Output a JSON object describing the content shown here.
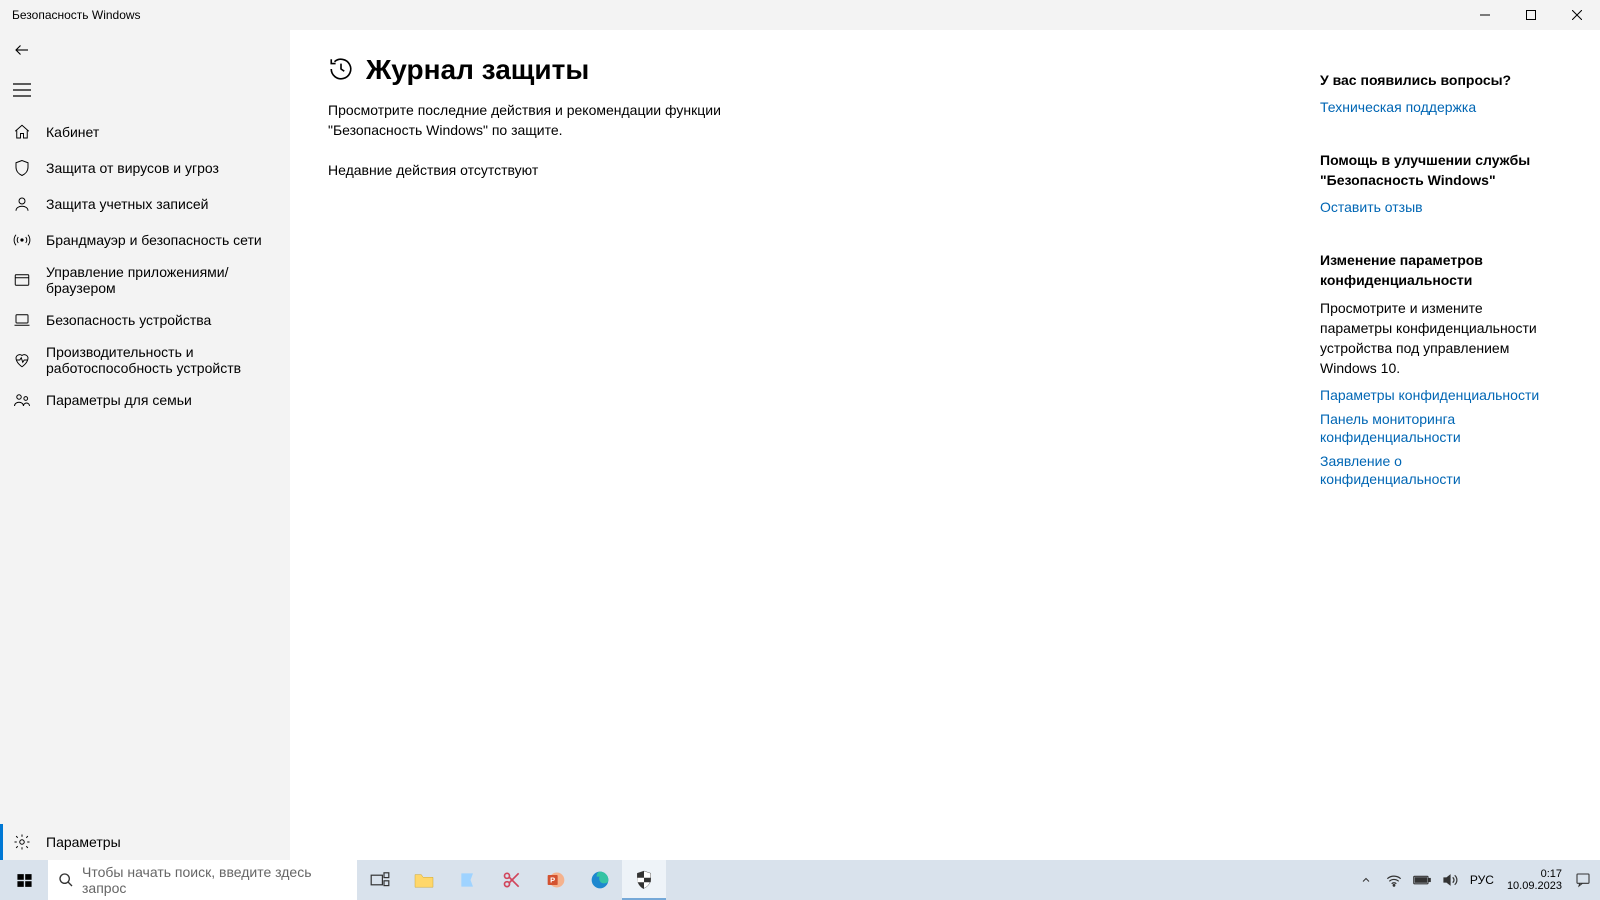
{
  "window": {
    "title": "Безопасность Windows"
  },
  "sidebar": {
    "items": [
      {
        "label": "Кабинет",
        "icon": "home-icon"
      },
      {
        "label": "Защита от вирусов и угроз",
        "icon": "shield-icon"
      },
      {
        "label": "Защита учетных записей",
        "icon": "person-icon"
      },
      {
        "label": "Брандмауэр и безопасность сети",
        "icon": "signal-icon"
      },
      {
        "label": "Управление приложениями/браузером",
        "icon": "window-icon"
      },
      {
        "label": "Безопасность устройства",
        "icon": "laptop-icon"
      },
      {
        "label": "Производительность и работоспособность устройств",
        "icon": "heart-icon"
      },
      {
        "label": "Параметры для семьи",
        "icon": "family-icon"
      }
    ],
    "footer": {
      "label": "Параметры",
      "icon": "gear-icon"
    }
  },
  "main": {
    "title": "Журнал защиты",
    "desc": "Просмотрите последние действия и рекомендации функции \"Безопасность Windows\" по защите.",
    "empty": "Недавние действия отсутствуют"
  },
  "side_panel": {
    "questions": {
      "heading": "У вас появились вопросы?",
      "link": "Техническая поддержка"
    },
    "feedback": {
      "heading": "Помощь в улучшении службы \"Безопасность Windows\"",
      "link": "Оставить отзыв"
    },
    "privacy": {
      "heading": "Изменение параметров конфиденциальности",
      "desc": "Просмотрите и измените параметры конфиденциальности устройства под управлением Windows 10.",
      "link1": "Параметры конфиденциальности",
      "link2": "Панель мониторинга конфиденциальности",
      "link3": "Заявление о конфиденциальности"
    }
  },
  "taskbar": {
    "search_placeholder": "Чтобы начать поиск, введите здесь запрос",
    "lang": "РУС",
    "time": "0:17",
    "date": "10.09.2023"
  }
}
